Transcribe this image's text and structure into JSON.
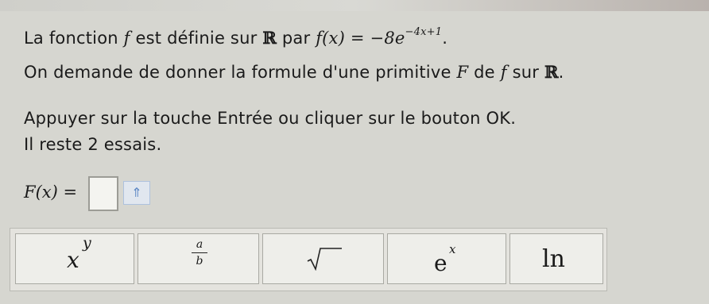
{
  "question": {
    "line1": {
      "text_a": "La fonction",
      "f": "f",
      "text_b": "est définie sur",
      "R": "ℝ",
      "text_c": "par",
      "expr": "f(x) = −8e",
      "exponent": "−4x+1",
      "end": "."
    },
    "line2": {
      "text_a": "On demande de donner la formule d'une primitive",
      "F": "F",
      "text_b": "de",
      "f": "f",
      "text_c": "sur",
      "R": "ℝ",
      "end": "."
    },
    "line3": "Appuyer sur la touche Entrée ou cliquer sur le bouton OK.",
    "line4": "Il reste 2 essais."
  },
  "answer": {
    "label": "F(x) =",
    "value": "",
    "arrow_icon": "⇑"
  },
  "keypad": {
    "power": {
      "base": "x",
      "exp": "y"
    },
    "fraction": {
      "num": "a",
      "den": "b"
    },
    "sqrt": "√",
    "exp": {
      "base": "e",
      "exp": "x"
    },
    "ln": "ln"
  }
}
